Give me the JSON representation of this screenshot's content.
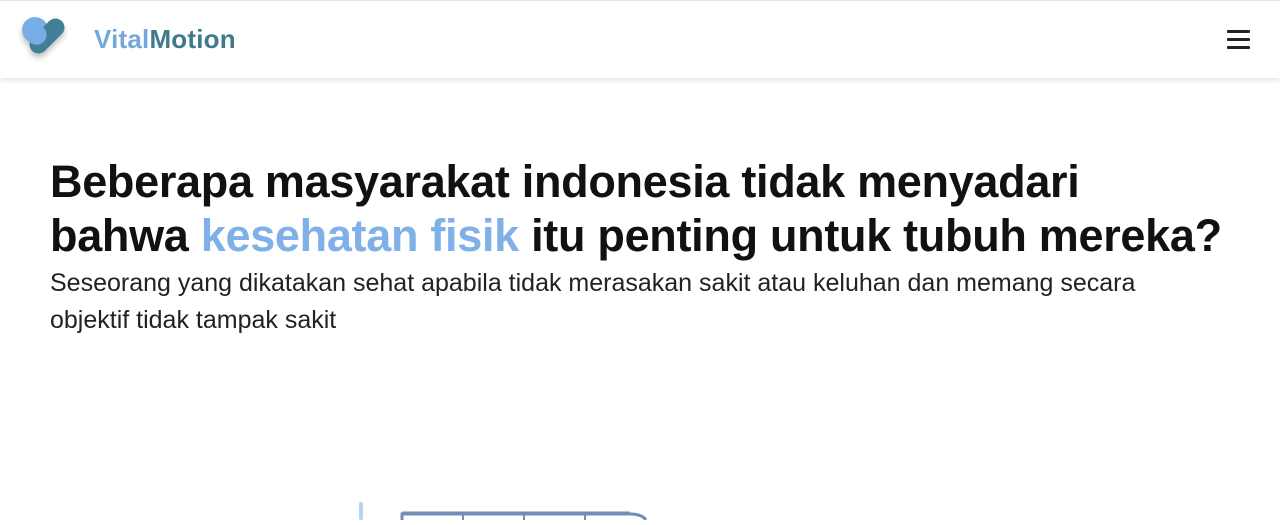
{
  "header": {
    "brand_part1": "Vital",
    "brand_part2": "Motion",
    "logo_icon": "heart-logo-icon",
    "menu_icon": "hamburger-menu-icon"
  },
  "hero": {
    "headline_line1": "Beberapa masyarakat indonesia tidak menyadari",
    "headline_before": "bahwa ",
    "headline_highlight": "kesehatan fisik",
    "headline_after": " itu penting untuk tubuh mereka?",
    "subtext": "Seseorang yang dikatakan sehat apabila tidak merasakan sakit atau keluhan dan memang secara objektif tidak tampak sakit"
  },
  "colors": {
    "brand_light_blue": "#73a8df",
    "brand_teal": "#3e7a8c",
    "highlight_blue": "#7fb0e8",
    "text_dark": "#111111"
  }
}
